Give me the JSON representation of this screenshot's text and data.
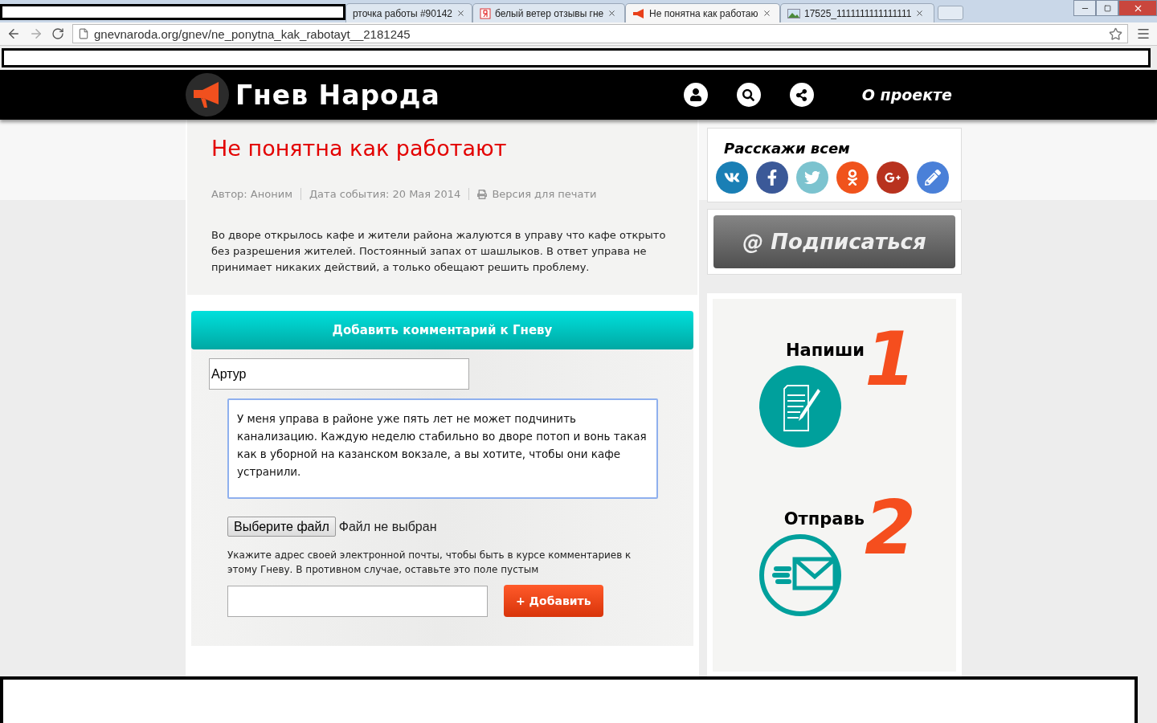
{
  "browser": {
    "tabs": [
      {
        "title": "рточка работы #90142",
        "selected": false
      },
      {
        "title": "белый ветер отзывы гне",
        "selected": false,
        "kind": "yandex"
      },
      {
        "title": "Не понятна как работаю",
        "selected": true,
        "kind": "megaphone"
      },
      {
        "title": "17525_1111111111111111",
        "selected": false,
        "kind": "image"
      }
    ],
    "address": "gnevnaroda.org/gnev/ne_ponytna_kak_rabotayt__2181245"
  },
  "site": {
    "logo": "Гнев Народа",
    "nav_link": "О проекте"
  },
  "article": {
    "title": "Не понятна как работают",
    "meta": [
      "Автор: Аноним",
      "Дата события: 20 Мая 2014",
      "Версия для печати"
    ],
    "body": "Во дворе открылось кафе и жители района жалуются в управу что кафе открыто без разрешения жителей. Постоянный запах от шашлыков. В ответ управа не принимает никаких действий, а только обещают решить проблему."
  },
  "comment_form": {
    "header": "Добавить комментарий к Гневу",
    "name_value": "Артур",
    "comment_value": "У меня управа в районе уже пять лет не может подчинить канализацию. Каждую неделю стабильно во дворе потоп и вонь такая как в уборной на казанском вокзале, а вы хотите, чтобы они кафе устранили.",
    "file_button": "Выберите файл",
    "file_status": "Файл не выбран",
    "email_hint": "Укажите адрес своей электронной почты, чтобы быть в курсе комментариев к этому Гневу. В противном случае, оставьте это поле пустым",
    "submit": "+ Добавить"
  },
  "sidebar": {
    "share_title": "Расскажи всем",
    "share_buttons": [
      {
        "kind": "vk",
        "color": "#1a7fb5"
      },
      {
        "kind": "facebook",
        "color": "#3b5998"
      },
      {
        "kind": "twitter",
        "color": "#7cc3cf"
      },
      {
        "kind": "odnoklassniki",
        "color": "#f0531c"
      },
      {
        "kind": "googleplus",
        "color": "#b8321e"
      },
      {
        "kind": "edit",
        "color": "#4a80d8"
      }
    ],
    "subscribe": "@ Подписаться",
    "steps": [
      {
        "label": "Напиши",
        "number": "1",
        "kind": "write"
      },
      {
        "label": "Отправь",
        "number": "2",
        "kind": "send"
      }
    ]
  }
}
